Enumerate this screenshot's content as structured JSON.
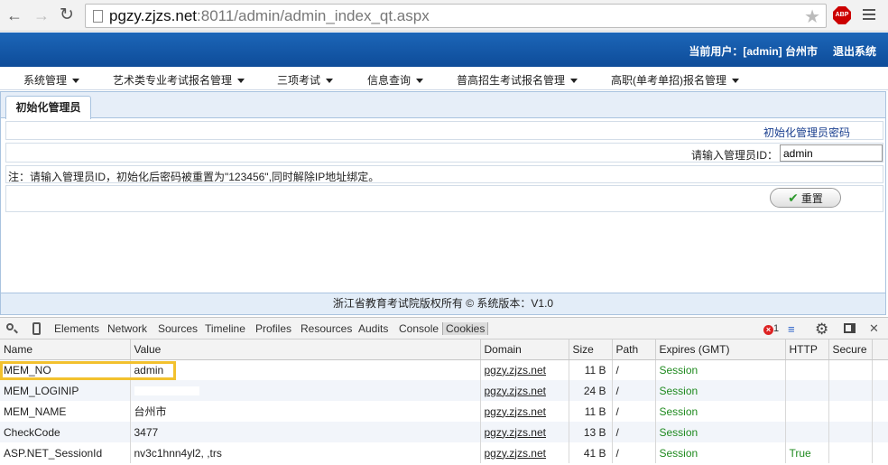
{
  "browser": {
    "url_host": "pgzy.zjzs.net",
    "url_rest": ":8011/admin/admin_index_qt.aspx",
    "adblock_label": "ABP"
  },
  "header": {
    "current_user": "当前用户：[admin] 台州市",
    "logout": "退出系统"
  },
  "menu": {
    "items": [
      {
        "label": "系统管理"
      },
      {
        "label": "艺术类专业考试报名管理"
      },
      {
        "label": "三项考试"
      },
      {
        "label": "信息查询"
      },
      {
        "label": "普高招生考试报名管理"
      },
      {
        "label": "高职(单考单招)报名管理"
      }
    ]
  },
  "panel": {
    "tab_label": "初始化管理员",
    "link_text": "初始化管理员密码",
    "id_label": "请输入管理员ID：",
    "id_value": "admin",
    "note": "注：请输入管理员ID，初始化后密码被重置为\"123456\",同时解除IP地址绑定。",
    "reset_label": "重置"
  },
  "footer": {
    "text": "浙江省教育考试院版权所有 ©    系统版本：V1.0"
  },
  "devtools": {
    "tabs": [
      "Elements",
      "Network",
      "Sources",
      "Timeline",
      "Profiles",
      "Resources",
      "Audits",
      "Console",
      "Cookies"
    ],
    "active_tab": "Cookies",
    "error_count": "1",
    "columns": [
      "Name",
      "Value",
      "Domain",
      "Size",
      "Path",
      "Expires (GMT)",
      "HTTP",
      "Secure"
    ],
    "cookies": [
      {
        "name": "MEM_NO",
        "value": "admin",
        "domain": "pgzy.zjzs.net",
        "size": "11 B",
        "path": "/",
        "expires": "Session",
        "http": "",
        "secure": ""
      },
      {
        "name": "MEM_LOGINIP",
        "value": "",
        "domain": "pgzy.zjzs.net",
        "size": "24 B",
        "path": "/",
        "expires": "Session",
        "http": "",
        "secure": ""
      },
      {
        "name": "MEM_NAME",
        "value": "台州市",
        "domain": "pgzy.zjzs.net",
        "size": "11 B",
        "path": "/",
        "expires": "Session",
        "http": "",
        "secure": ""
      },
      {
        "name": "CheckCode",
        "value": "3477",
        "domain": "pgzy.zjzs.net",
        "size": "13 B",
        "path": "/",
        "expires": "Session",
        "http": "",
        "secure": ""
      },
      {
        "name": "ASP.NET_SessionId",
        "value": "nv3c1hnn4yl2,              ,trs",
        "domain": "pgzy.zjzs.net",
        "size": "41 B",
        "path": "/",
        "expires": "Session",
        "http": "True",
        "secure": ""
      }
    ],
    "colors": {
      "session": "#1f8a1f",
      "highlight": "#f2c12e"
    }
  }
}
